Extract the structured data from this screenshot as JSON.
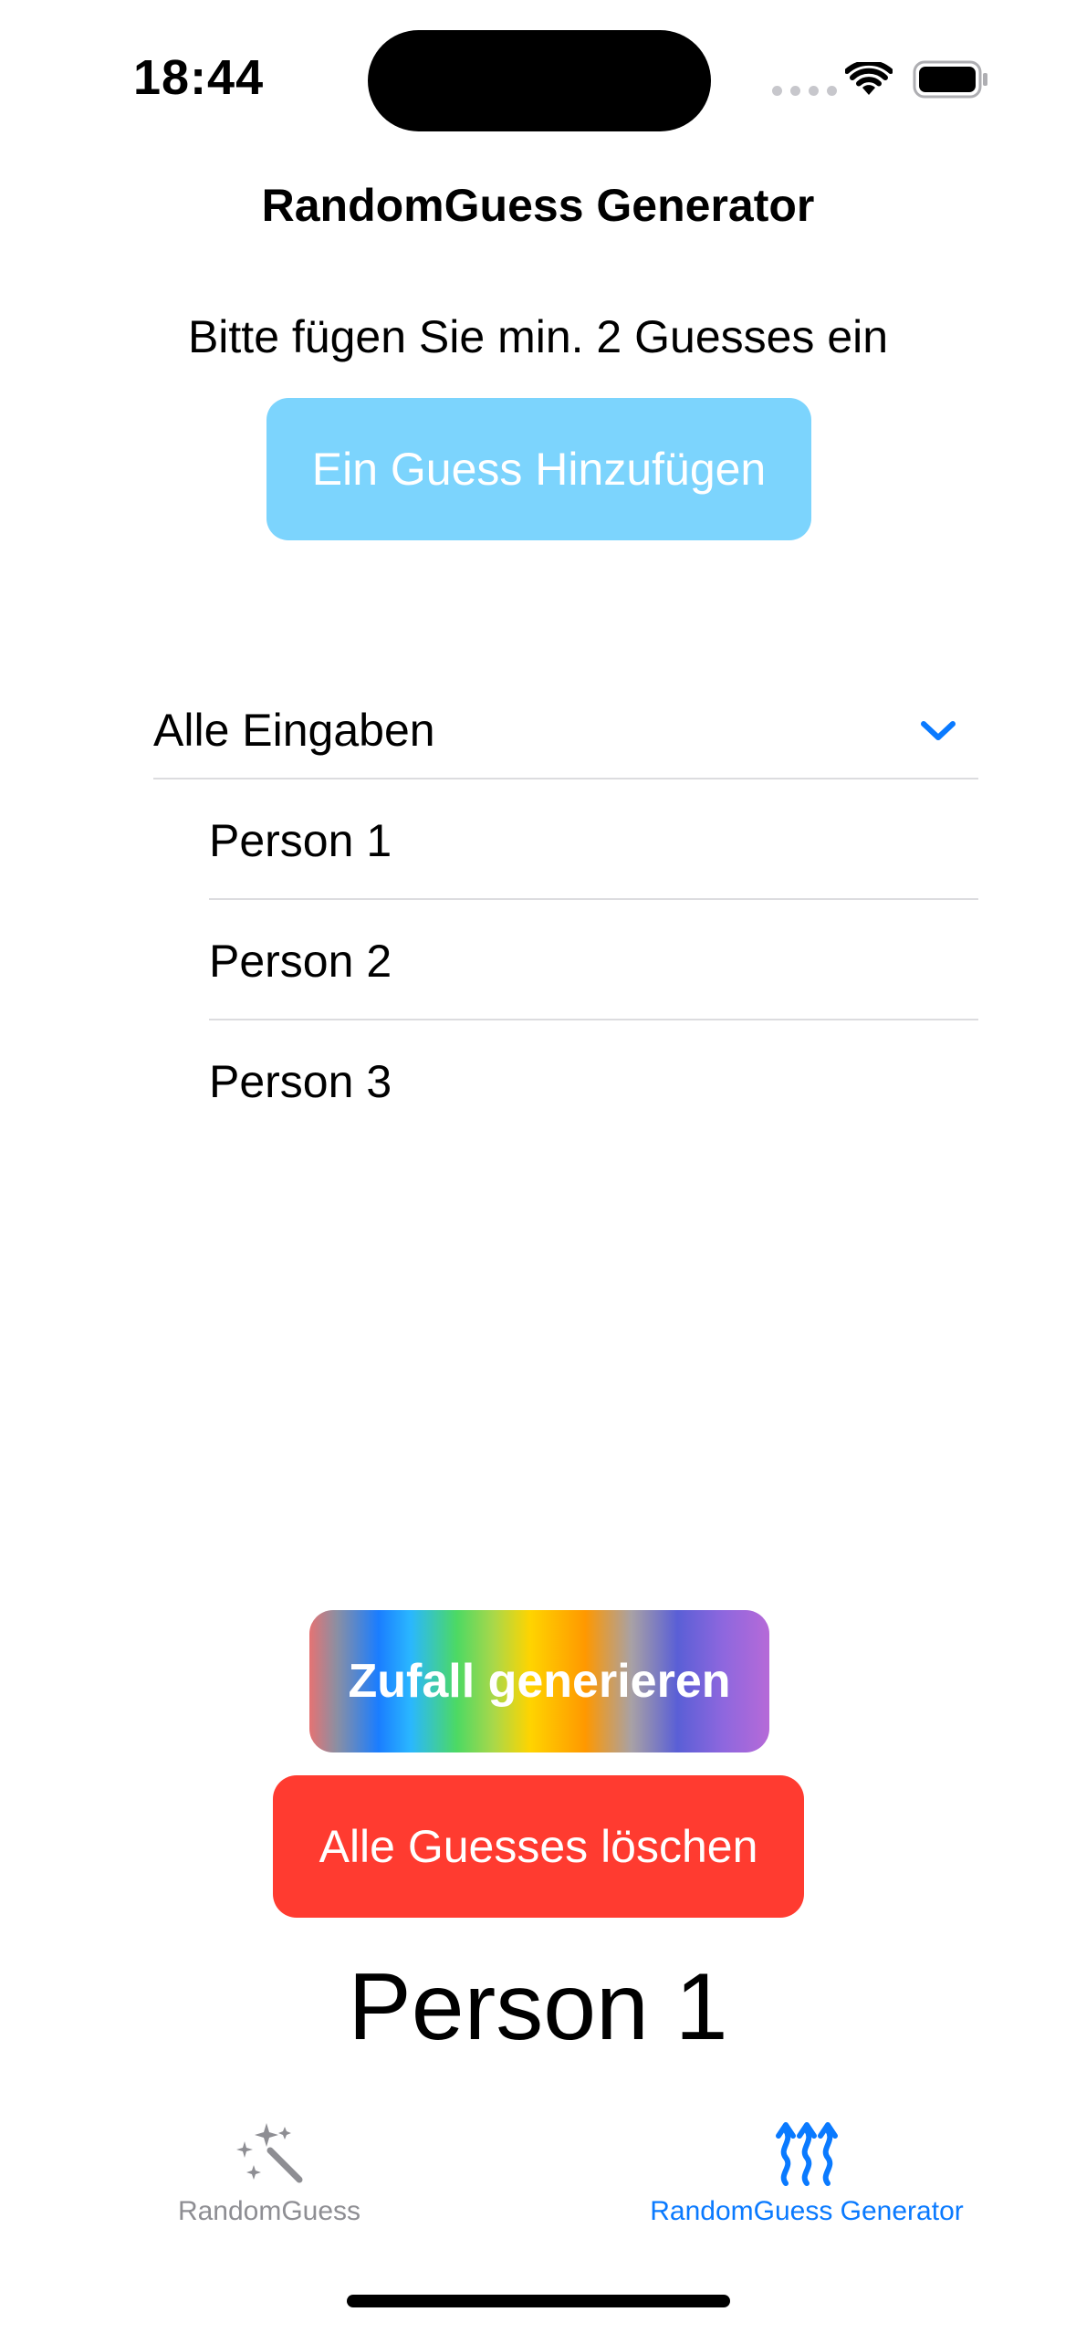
{
  "status_bar": {
    "time": "18:44"
  },
  "nav": {
    "title": "RandomGuess Generator"
  },
  "hint": "Bitte fügen Sie min. 2 Guesses ein",
  "add_button_label": "Ein Guess Hinzufügen",
  "list": {
    "header": "Alle Eingaben",
    "items": [
      "Person 1",
      "Person 2",
      "Person 3"
    ]
  },
  "generate_button_label": "Zufall generieren",
  "delete_button_label": "Alle Guesses löschen",
  "result": "Person 1",
  "tabs": [
    {
      "label": "RandomGuess",
      "icon": "magic-wand-icon",
      "selected": false
    },
    {
      "label": "RandomGuess Generator",
      "icon": "heat-waves-icon",
      "selected": true
    }
  ],
  "colors": {
    "accent": "#0a7aff",
    "add_button": "#7cd4fd",
    "delete_button": "#ff3b30",
    "inactive_tab": "#8e8e93"
  }
}
